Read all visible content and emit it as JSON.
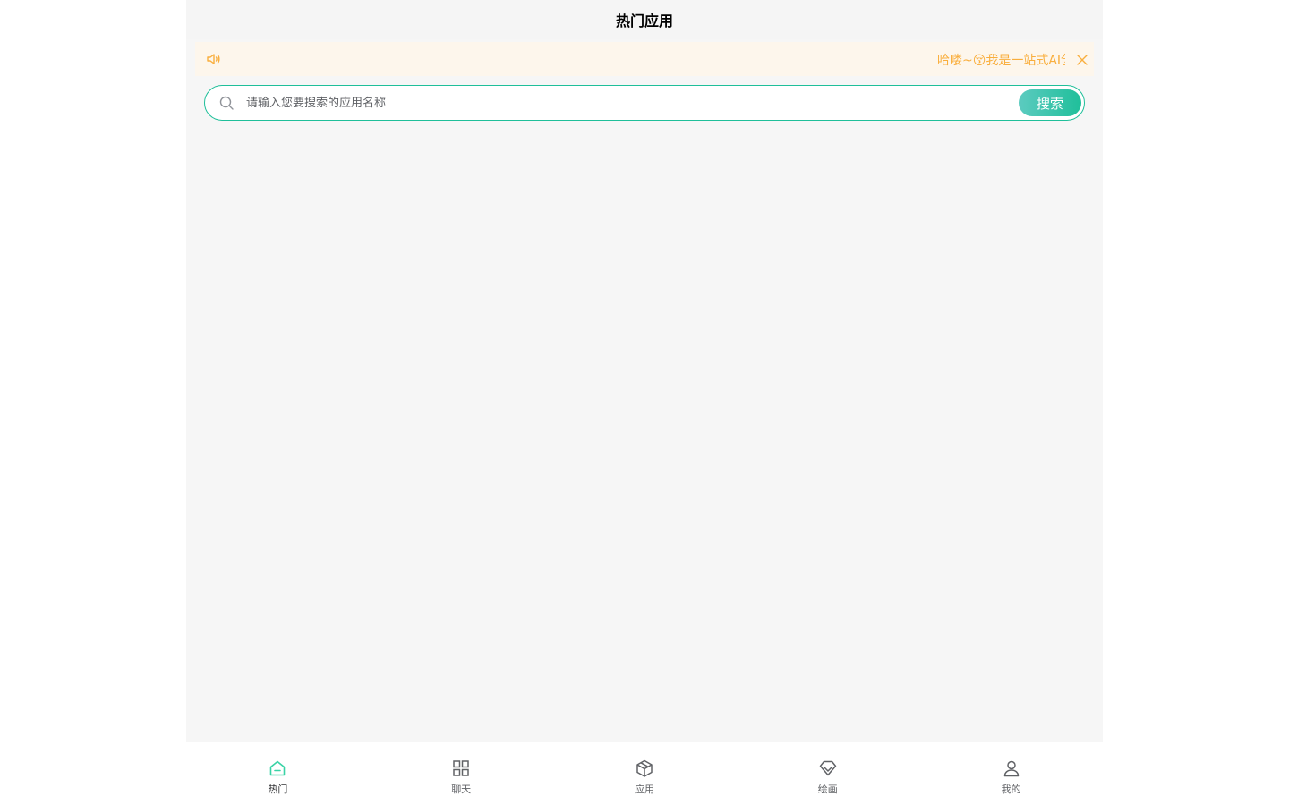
{
  "navbar": {
    "title": "热门应用"
  },
  "notice": {
    "icon": "volume-icon",
    "text": "哈喽~😚我是一站式AI创作平台",
    "close_icon": "close-icon",
    "color": "#f9ae3d"
  },
  "search": {
    "placeholder": "请输入您要搜索的应用名称",
    "value": "",
    "button_label": "搜索",
    "accent": "#1fbf9a"
  },
  "tabbar": {
    "active_color": "#39d3a6",
    "items": [
      {
        "label": "热门",
        "icon": "home-icon",
        "active": true
      },
      {
        "label": "聊天",
        "icon": "grid-icon",
        "active": false
      },
      {
        "label": "应用",
        "icon": "cube-icon",
        "active": false
      },
      {
        "label": "绘画",
        "icon": "diamond-icon",
        "active": false
      },
      {
        "label": "我的",
        "icon": "user-icon",
        "active": false
      }
    ]
  }
}
